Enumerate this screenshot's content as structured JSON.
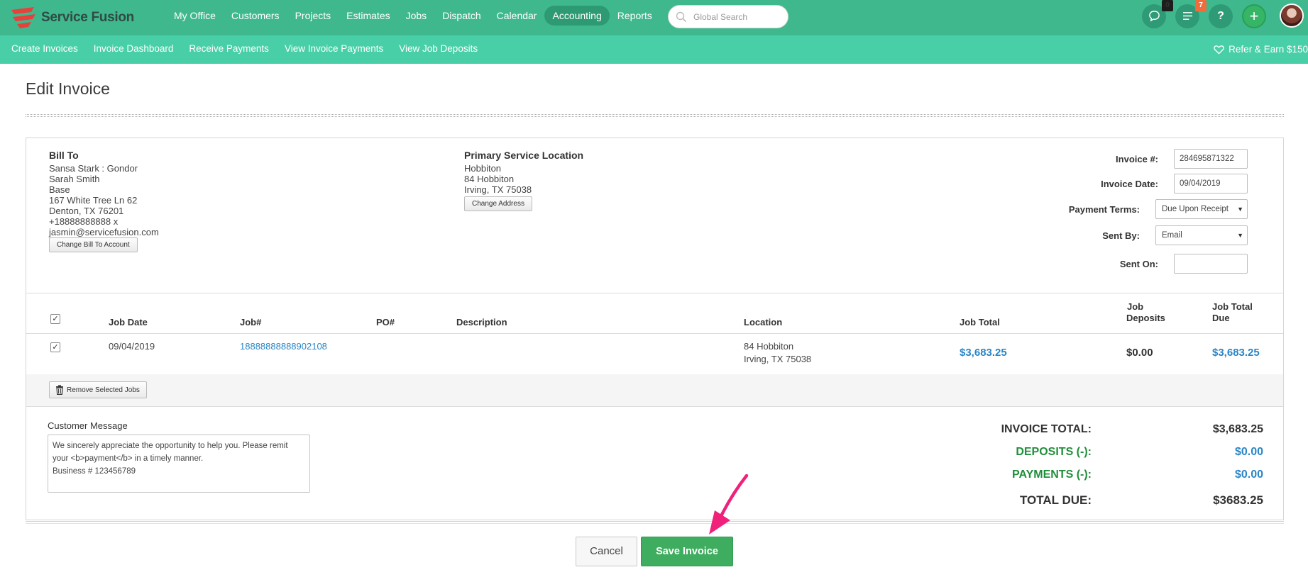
{
  "app": {
    "brand": "Service Fusion",
    "nav": [
      "My Office",
      "Customers",
      "Projects",
      "Estimates",
      "Jobs",
      "Dispatch",
      "Calendar",
      "Accounting",
      "Reports"
    ],
    "active_nav": "Accounting",
    "search_placeholder": "Global Search",
    "chat_count": "0",
    "notif_count": "7",
    "help_label": "?",
    "plus_label": "+"
  },
  "subnav": {
    "items": [
      "Create Invoices",
      "Invoice Dashboard",
      "Receive Payments",
      "View Invoice Payments",
      "View Job Deposits"
    ],
    "refer": "Refer & Earn $150"
  },
  "page": {
    "title": "Edit Invoice"
  },
  "bill_to": {
    "label": "Bill To",
    "lines": [
      "Sansa Stark : Gondor",
      "Sarah Smith",
      "Base",
      "167 White Tree Ln 62",
      "Denton, TX 76201",
      "+18888888888 x",
      "jasmin@servicefusion.com"
    ],
    "button": "Change Bill To Account"
  },
  "service_location": {
    "label": "Primary Service Location",
    "lines": [
      "Hobbiton",
      "84 Hobbiton",
      "Irving, TX 75038"
    ],
    "button": "Change Address"
  },
  "meta": {
    "invoice_no_label": "Invoice #:",
    "invoice_no": "284695871322",
    "invoice_date_label": "Invoice Date:",
    "invoice_date": "09/04/2019",
    "payment_terms_label": "Payment Terms:",
    "payment_terms": "Due Upon Receipt",
    "sent_by_label": "Sent By:",
    "sent_by": "Email",
    "sent_on_label": "Sent On:",
    "sent_on": ""
  },
  "table": {
    "headers": {
      "job_date": "Job Date",
      "job_no": "Job#",
      "po_no": "PO#",
      "description": "Description",
      "location": "Location",
      "job_total": "Job Total",
      "job_deposits_1": "Job",
      "job_deposits_2": "Deposits",
      "job_total_due_1": "Job Total",
      "job_total_due_2": "Due"
    },
    "rows": [
      {
        "checked": true,
        "job_date": "09/04/2019",
        "job_no": "18888888888902108",
        "po_no": "",
        "description": "",
        "location_1": "84 Hobbiton",
        "location_2": "Irving, TX 75038",
        "job_total": "$3,683.25",
        "job_deposits": "$0.00",
        "job_total_due": "$3,683.25"
      }
    ],
    "remove_button": "Remove Selected Jobs"
  },
  "customer_message": {
    "label": "Customer Message",
    "text": "We sincerely appreciate the opportunity to help you. Please remit your <b>payment</b> in a timely manner.\nBusiness # 123456789"
  },
  "totals": {
    "invoice_total_label": "INVOICE TOTAL:",
    "invoice_total": "$3,683.25",
    "deposits_label": "DEPOSITS (-):",
    "deposits": "$0.00",
    "payments_label": "PAYMENTS (-):",
    "payments": "$0.00",
    "total_due_label": "TOTAL DUE:",
    "total_due": "$3683.25"
  },
  "actions": {
    "cancel": "Cancel",
    "save": "Save Invoice"
  },
  "colors": {
    "topbar": "#3fb88e",
    "subbar": "#49cfa7",
    "link_blue": "#2a86c7",
    "deposit_green": "#1e8f3a",
    "save_green": "#3fad5f",
    "annotation_arrow": "#f0217a"
  }
}
